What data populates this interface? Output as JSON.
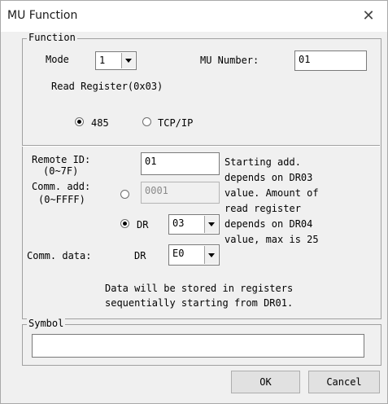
{
  "window": {
    "title": "MU Function",
    "close_glyph": "✕"
  },
  "function_group": {
    "legend": "Function",
    "mode_label": "Mode",
    "mode_value": "1",
    "mu_number_label": "MU Number:",
    "mu_number_value": "01",
    "read_register_text": "Read Register(0x03)",
    "radio_485_label": "485",
    "radio_485_checked": true,
    "radio_tcpip_label": "TCP/IP",
    "radio_tcpip_checked": false,
    "remote_id_label": "Remote ID:",
    "remote_id_range": "(0~7F)",
    "remote_id_value": "01",
    "comm_add_label": "Comm. add:",
    "comm_add_range": "(0~FFFF)",
    "comm_add_value": "0001",
    "comm_add_radio_checked": false,
    "dr_radio_label": "DR",
    "dr_radio_checked": true,
    "dr_value": "03",
    "info_lines": [
      "Starting add.",
      "depends on DR03",
      "value. Amount of",
      "read register",
      "depends on DR04",
      "value, max is 25"
    ],
    "comm_data_label": "Comm. data:",
    "comm_data_dr_label": "DR",
    "comm_data_value": "E0",
    "storage_note_lines": [
      "Data will be stored in registers",
      "sequentially starting from DR01."
    ]
  },
  "symbol_group": {
    "legend": "Symbol",
    "value": ""
  },
  "buttons": {
    "ok": "OK",
    "cancel": "Cancel"
  }
}
